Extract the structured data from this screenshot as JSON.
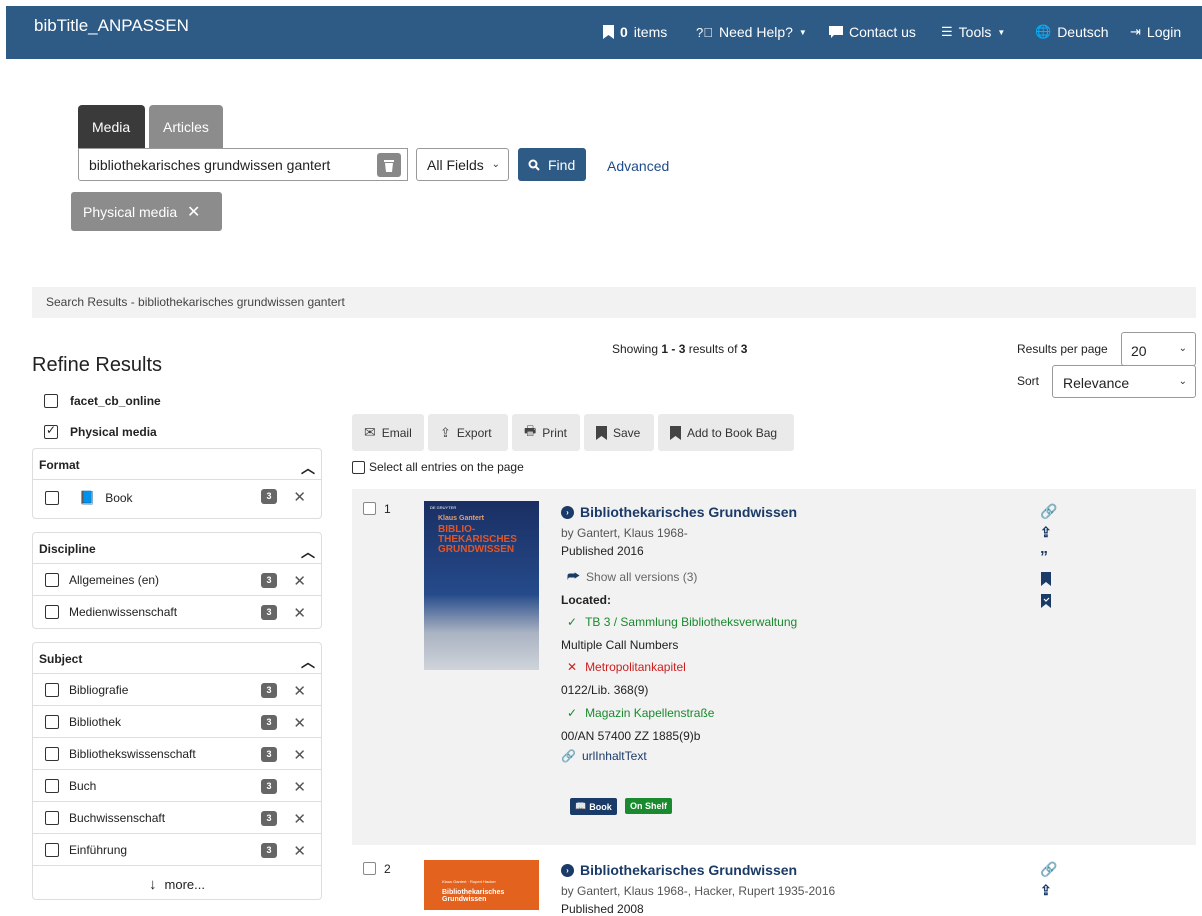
{
  "header": {
    "brand": "bibTitle_ANPASSEN",
    "items_count": "0",
    "items_label": "items",
    "help": "Need Help?",
    "contact": "Contact us",
    "tools": "Tools",
    "language": "Deutsch",
    "login": "Login"
  },
  "search": {
    "tab_media": "Media",
    "tab_articles": "Articles",
    "query": "bibliothekarisches grundwissen gantert",
    "field": "All Fields",
    "find": "Find",
    "advanced": "Advanced",
    "filter": "Physical media"
  },
  "breadcrumb": "Search Results - bibliothekarisches grundwissen gantert",
  "refine": {
    "title": "Refine Results",
    "checks": [
      {
        "label": "facet_cb_online",
        "checked": false
      },
      {
        "label": "Physical media",
        "checked": true
      }
    ],
    "format": {
      "title": "Format",
      "items": [
        {
          "label": "Book",
          "count": "3"
        }
      ]
    },
    "discipline": {
      "title": "Discipline",
      "items": [
        {
          "label": "Allgemeines (en)",
          "count": "3"
        },
        {
          "label": "Medienwissenschaft",
          "count": "3"
        }
      ]
    },
    "subject": {
      "title": "Subject",
      "items": [
        {
          "label": "Bibliografie",
          "count": "3"
        },
        {
          "label": "Bibliothek",
          "count": "3"
        },
        {
          "label": "Bibliothekswissenschaft",
          "count": "3"
        },
        {
          "label": "Buch",
          "count": "3"
        },
        {
          "label": "Buchwissenschaft",
          "count": "3"
        },
        {
          "label": "Einführung",
          "count": "3"
        }
      ],
      "more": "more..."
    }
  },
  "results_info": {
    "prefix": "Showing",
    "range": "1 - 3",
    "mid": "results of",
    "total": "3",
    "rpp_label": "Results per page",
    "rpp": "20",
    "sort_label": "Sort",
    "sort": "Relevance"
  },
  "toolbar": {
    "email": "Email",
    "export": "Export",
    "print": "Print",
    "save": "Save",
    "bookbag": "Add to Book Bag",
    "select_all": "Select all entries on the page"
  },
  "results": [
    {
      "num": "1",
      "title": "Bibliothekarisches Grundwissen",
      "by": "by Gantert, Klaus 1968-",
      "published": "Published 2016",
      "versions": "Show all versions (3)",
      "located": "Located:",
      "loc1": "TB 3 / Sammlung Bibliotheksverwaltung",
      "call1": "Multiple Call Numbers",
      "loc2": "Metropolitankapitel",
      "call2": "0122/Lib. 368(9)",
      "loc3": "Magazin Kapellenstraße",
      "call3": "00/AN 57400 ZZ 1885(9)b",
      "link": "urlInhaltText",
      "tag_format": "Book",
      "tag_status": "On Shelf",
      "cover": {
        "author": "Klaus Gantert",
        "title": "BIBLIO-THEKARISCHES GRUNDWISSEN",
        "publisher": "DE GRUYTER"
      }
    },
    {
      "num": "2",
      "title": "Bibliothekarisches Grundwissen",
      "by": "by Gantert, Klaus 1968-, Hacker, Rupert 1935-2016",
      "published": "Published 2008",
      "cover": {
        "author": "Klaus Gantert · Rupert Hacker",
        "title": "Bibliothekarisches Grundwissen"
      }
    }
  ]
}
